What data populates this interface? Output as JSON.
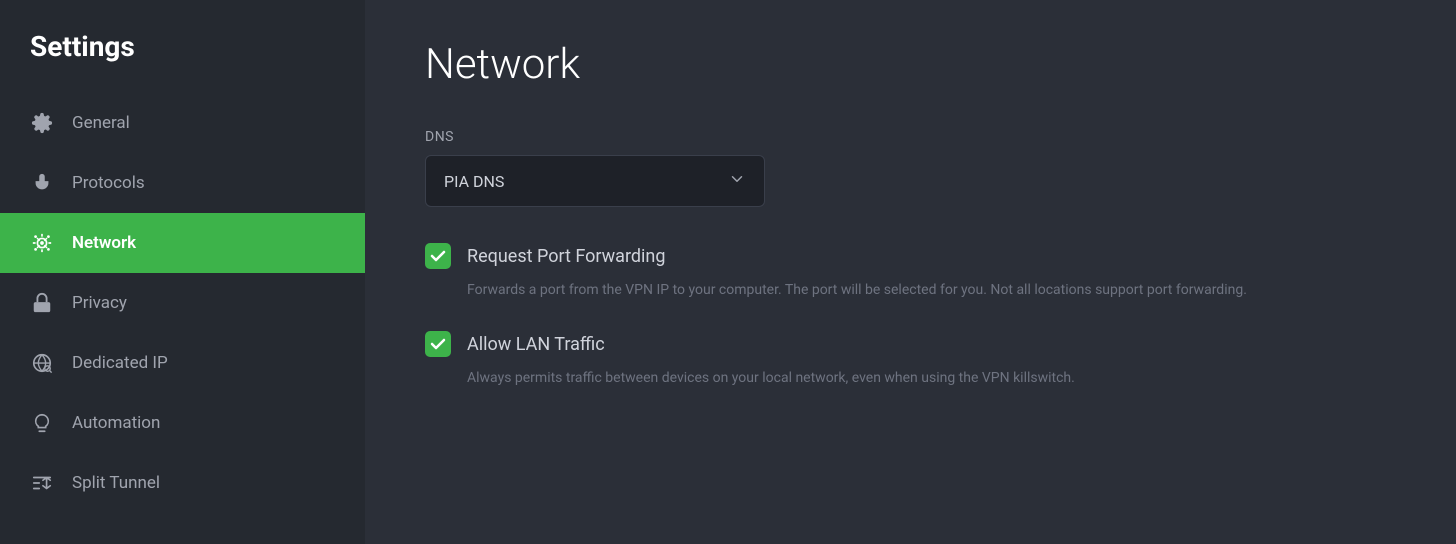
{
  "sidebar": {
    "title": "Settings",
    "items": [
      {
        "id": "general",
        "label": "General",
        "icon": "gear"
      },
      {
        "id": "protocols",
        "label": "Protocols",
        "icon": "mic"
      },
      {
        "id": "network",
        "label": "Network",
        "icon": "network",
        "active": true
      },
      {
        "id": "privacy",
        "label": "Privacy",
        "icon": "lock"
      },
      {
        "id": "dedicated-ip",
        "label": "Dedicated IP",
        "icon": "globe-key"
      },
      {
        "id": "automation",
        "label": "Automation",
        "icon": "lightbulb"
      },
      {
        "id": "split-tunnel",
        "label": "Split Tunnel",
        "icon": "split"
      }
    ]
  },
  "main": {
    "page_title": "Network",
    "dns_label": "DNS",
    "dns_value": "PIA DNS",
    "settings": [
      {
        "id": "port-forwarding",
        "label": "Request Port Forwarding",
        "enabled": true,
        "description": "Forwards a port from the VPN IP to your computer. The port will be selected for you. Not all locations support port forwarding."
      },
      {
        "id": "allow-lan",
        "label": "Allow LAN Traffic",
        "enabled": true,
        "description": "Always permits traffic between devices on your local network, even when using the VPN killswitch."
      }
    ]
  }
}
